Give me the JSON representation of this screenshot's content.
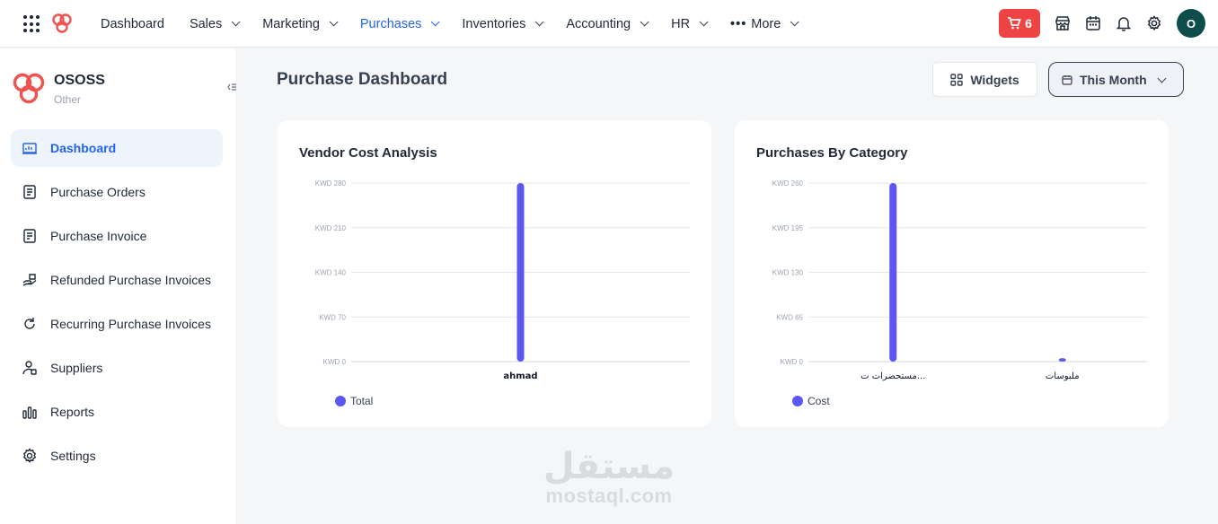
{
  "topbar": {
    "nav": [
      {
        "label": "Dashboard",
        "dropdown": false,
        "active": false
      },
      {
        "label": "Sales",
        "dropdown": true,
        "active": false
      },
      {
        "label": "Marketing",
        "dropdown": true,
        "active": false
      },
      {
        "label": "Purchases",
        "dropdown": true,
        "active": true
      },
      {
        "label": "Inventories",
        "dropdown": true,
        "active": false
      },
      {
        "label": "Accounting",
        "dropdown": true,
        "active": false
      },
      {
        "label": "HR",
        "dropdown": true,
        "active": false
      },
      {
        "label": "More",
        "dropdown": true,
        "active": false,
        "dots": true
      }
    ],
    "cart_count": "6",
    "avatar_initial": "O",
    "colors": {
      "accent": "#2563eb",
      "cart": "#ef4444",
      "avatar": "#0f4c4c",
      "series": "#5b57f0"
    }
  },
  "sidebar": {
    "company_name": "OSOSS",
    "company_type": "Other",
    "items": [
      {
        "label": "Dashboard",
        "icon": "dashboard-icon",
        "active": true
      },
      {
        "label": "Purchase Orders",
        "icon": "orders-icon",
        "active": false
      },
      {
        "label": "Purchase Invoice",
        "icon": "invoice-icon",
        "active": false
      },
      {
        "label": "Refunded Purchase Invoices",
        "icon": "refund-icon",
        "active": false
      },
      {
        "label": "Recurring Purchase Invoices",
        "icon": "recurring-icon",
        "active": false
      },
      {
        "label": "Suppliers",
        "icon": "suppliers-icon",
        "active": false
      },
      {
        "label": "Reports",
        "icon": "reports-icon",
        "active": false
      },
      {
        "label": "Settings",
        "icon": "settings-icon",
        "active": false
      }
    ]
  },
  "main": {
    "title": "Purchase Dashboard",
    "widgets_label": "Widgets",
    "period_label": "This Month"
  },
  "chart_data": [
    {
      "type": "bar",
      "title": "Vendor Cost Analysis",
      "categories": [
        "ahmad"
      ],
      "series": [
        {
          "name": "Total",
          "values": [
            280
          ]
        }
      ],
      "yticks": [
        "KWD 0",
        "KWD 70",
        "KWD 140",
        "KWD 210",
        "KWD 280"
      ],
      "ylim": [
        0,
        280
      ],
      "legend": "bottom-left",
      "grid": true
    },
    {
      "type": "bar",
      "title": "Purchases By Category",
      "categories": [
        "مستحضرات ت...",
        "ملبوسات"
      ],
      "series": [
        {
          "name": "Cost",
          "values": [
            260,
            5
          ]
        }
      ],
      "yticks": [
        "KWD 0",
        "KWD 65",
        "KWD 130",
        "KWD 195",
        "KWD 260"
      ],
      "ylim": [
        0,
        260
      ],
      "legend": "bottom-left",
      "grid": true
    }
  ],
  "watermark": {
    "arabic": "مستقل",
    "latin": "mostaql.com"
  }
}
